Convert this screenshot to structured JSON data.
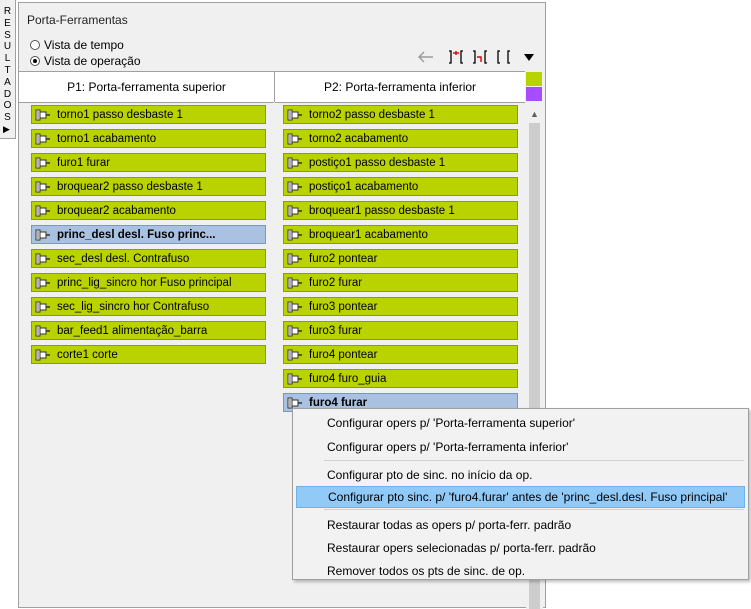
{
  "side_tab": {
    "label": "RESULTADOS"
  },
  "panel": {
    "title": "Porta-Ferramentas",
    "view_options": [
      {
        "label": "Vista de tempo",
        "selected": false
      },
      {
        "label": "Vista de operação",
        "selected": true
      }
    ],
    "toolbar_icons": [
      "back-arrow-icon",
      "sync-left-icon",
      "sync-right-icon",
      "bracket-icon",
      "dropdown-icon"
    ]
  },
  "columns": {
    "left_header": "P1: Porta-ferramenta superior",
    "right_header": "P2: Porta-ferramenta inferior"
  },
  "legend_colors": {
    "operation": "#b9d300",
    "sync": "#a64dff",
    "selected": "#a9c2e2"
  },
  "left_ops": [
    {
      "label": "torno1  passo desbaste 1",
      "selected": false
    },
    {
      "label": "torno1  acabamento",
      "selected": false
    },
    {
      "label": "furo1  furar",
      "selected": false
    },
    {
      "label": "broquear2  passo desbaste 1",
      "selected": false
    },
    {
      "label": "broquear2  acabamento",
      "selected": false
    },
    {
      "label": "princ_desl  desl. Fuso princ...",
      "selected": true
    },
    {
      "label": "sec_desl  desl. Contrafuso",
      "selected": false
    },
    {
      "label": "princ_lig_sincro  hor Fuso principal",
      "selected": false
    },
    {
      "label": "sec_lig_sincro  hor Contrafuso",
      "selected": false
    },
    {
      "label": "bar_feed1  alimentação_barra",
      "selected": false
    },
    {
      "label": "corte1  corte",
      "selected": false
    }
  ],
  "right_ops": [
    {
      "label": "torno2  passo desbaste 1",
      "selected": false
    },
    {
      "label": "torno2  acabamento",
      "selected": false
    },
    {
      "label": "postiço1  passo desbaste 1",
      "selected": false
    },
    {
      "label": "postiço1  acabamento",
      "selected": false
    },
    {
      "label": "broquear1  passo desbaste 1",
      "selected": false
    },
    {
      "label": "broquear1  acabamento",
      "selected": false
    },
    {
      "label": "furo2  pontear",
      "selected": false
    },
    {
      "label": "furo2  furar",
      "selected": false
    },
    {
      "label": "furo3  pontear",
      "selected": false
    },
    {
      "label": "furo3  furar",
      "selected": false
    },
    {
      "label": "furo4  pontear",
      "selected": false
    },
    {
      "label": "furo4  furo_guia",
      "selected": false
    },
    {
      "label": "furo4  furar",
      "selected": true
    }
  ],
  "context_menu": {
    "items": [
      "Configurar opers p/ 'Porta-ferramenta superior'",
      "Configurar opers p/ 'Porta-ferramenta inferior'",
      "Configurar pto de sinc. no início da op.",
      "Configurar pto sinc. p/ 'furo4.furar' antes de 'princ_desl.desl. Fuso principal'",
      "Restaurar todas as opers p/ porta-ferr. padrão",
      "Restaurar opers selecionadas p/ porta-ferr. padrão",
      "Remover todos os pts de sinc. de op."
    ],
    "highlighted_index": 3
  }
}
